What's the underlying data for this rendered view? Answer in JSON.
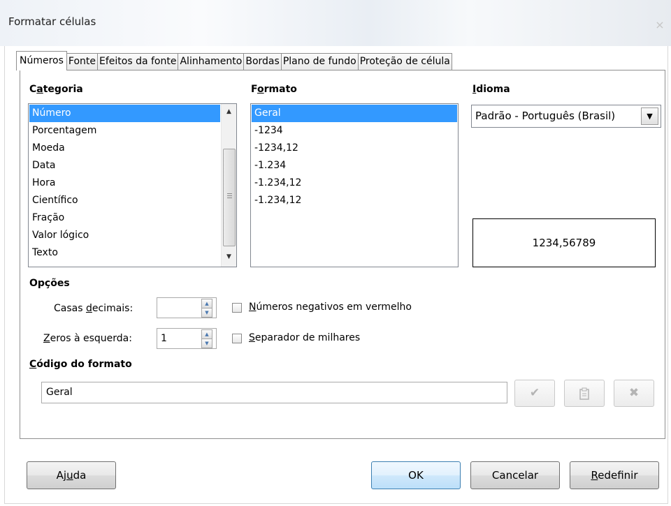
{
  "window": {
    "title": "Formatar células",
    "close_glyph": "×"
  },
  "tabs": [
    {
      "label": "Números",
      "active": true
    },
    {
      "label": "Fonte"
    },
    {
      "label": "Efeitos da fonte"
    },
    {
      "label": "Alinhamento"
    },
    {
      "label": "Bordas"
    },
    {
      "label": "Plano de fundo"
    },
    {
      "label": "Proteção de célula"
    }
  ],
  "category": {
    "label_pre": "C",
    "label_mn": "a",
    "label_post": "tegoria",
    "items": [
      "Número",
      "Porcentagem",
      "Moeda",
      "Data",
      "Hora",
      "Científico",
      "Fração",
      "Valor lógico",
      "Texto"
    ],
    "selected": "Número"
  },
  "format": {
    "label_pre": "F",
    "label_mn": "o",
    "label_post": "rmato",
    "items": [
      "Geral",
      "-1234",
      "-1234,12",
      "-1.234",
      "-1.234,12",
      "-1.234,12"
    ],
    "selected": "Geral"
  },
  "language": {
    "label_pre": "",
    "label_mn": "I",
    "label_post": "dioma",
    "selected": "Padrão - Português (Brasil)"
  },
  "preview": {
    "text": "1234,56789"
  },
  "options": {
    "header": "Opções",
    "decimal_label_pre": "Casas ",
    "decimal_label_mn": "d",
    "decimal_label_post": "ecimais:",
    "decimal_value": "",
    "zeros_label_pre": "",
    "zeros_label_mn": "Z",
    "zeros_label_post": "eros à esquerda:",
    "zeros_value": "1",
    "negative_red_pre": "",
    "negative_red_mn": "N",
    "negative_red_post": "úmeros negativos em vermelho",
    "negative_red_checked": false,
    "thousands_pre": "",
    "thousands_mn": "S",
    "thousands_post": "eparador de milhares",
    "thousands_checked": false
  },
  "format_code": {
    "header_pre": "",
    "header_mn": "C",
    "header_post": "ódigo do formato",
    "value": "Geral",
    "icons": [
      "checkmark-icon",
      "comment-icon",
      "delete-icon"
    ]
  },
  "buttons": {
    "help_pre": "Aj",
    "help_mn": "u",
    "help_post": "da",
    "ok": "OK",
    "cancel": "Cancelar",
    "reset_pre": "",
    "reset_mn": "R",
    "reset_post": "edefinir"
  },
  "colors": {
    "selection": "#3399ff",
    "default_button": "#bcdff9"
  }
}
